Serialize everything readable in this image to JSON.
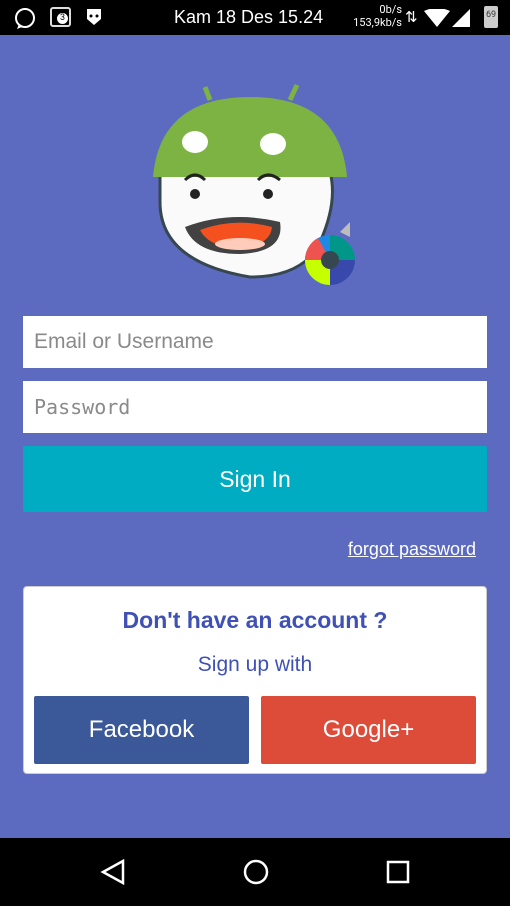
{
  "status_bar": {
    "time": "Kam 18 Des 15.24",
    "upload": "0b/s",
    "download": "153,9kb/s",
    "battery": "69",
    "notification_count": "3"
  },
  "login": {
    "email_placeholder": "Email or Username",
    "password_placeholder": "Password",
    "sign_in": "Sign In",
    "forgot": "forgot password"
  },
  "signup": {
    "title": "Don't have an account ?",
    "subtitle": "Sign up with",
    "facebook": "Facebook",
    "google": "Google+"
  },
  "colors": {
    "background": "#5c6bc0",
    "accent": "#00acc1",
    "facebook": "#3b5998",
    "google": "#dd4b39"
  }
}
